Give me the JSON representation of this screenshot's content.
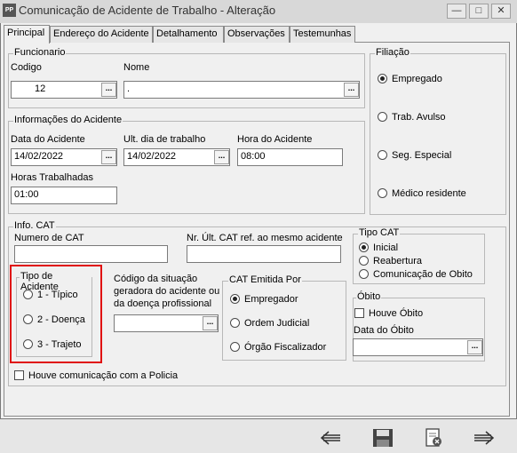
{
  "window": {
    "icon_text": "PP",
    "title": "Comunicação de Acidente de Trabalho - Alteração"
  },
  "tabs": [
    "Principal",
    "Endereço do Acidente",
    "Detalhamento",
    "Observações",
    "Testemunhas"
  ],
  "funcionario": {
    "group_label": "Funcionario",
    "codigo_label": "Codigo",
    "codigo_value": "12",
    "nome_label": "Nome",
    "nome_value": "."
  },
  "filiacao": {
    "group_label": "Filiação",
    "options": [
      "Empregado",
      "Trab. Avulso",
      "Seg. Especial",
      "Médico residente"
    ],
    "selected": "Empregado"
  },
  "acidente": {
    "group_label": "Informações do Acidente",
    "data_label": "Data do Acidente",
    "data_value": "14/02/2022",
    "ult_label": "Ult. dia de trabalho",
    "ult_value": "14/02/2022",
    "hora_label": "Hora do Acidente",
    "hora_value": "08:00",
    "horas_label": "Horas Trabalhadas",
    "horas_value": "01:00"
  },
  "cat": {
    "group_label": "Info. CAT",
    "numero_label": "Numero de CAT",
    "numero_value": "",
    "nr_ult_label": "Nr. Últ. CAT ref. ao mesmo acidente",
    "nr_ult_value": "",
    "tipo_cat_label": "Tipo CAT",
    "tipo_cat_options": [
      "Inicial",
      "Reabertura",
      "Comunicação de Obito"
    ],
    "tipo_cat_selected": "Inicial",
    "tipo_acidente_label": "Tipo de Acidente",
    "tipo_acidente_options": [
      "1 - Típico",
      "2 - Doença",
      "3 - Trajeto"
    ],
    "codigo_sit_label_1": "Código da situação",
    "codigo_sit_label_2": "geradora do acidente ou",
    "codigo_sit_label_3": "da doença profissional",
    "codigo_sit_value": "",
    "emitida_label": "CAT Emitida Por",
    "emitida_options": [
      "Empregador",
      "Ordem Judicial",
      "Órgão Fiscalizador"
    ],
    "emitida_selected": "Empregador",
    "obito_label": "Óbito",
    "houve_obito_label": "Houve Óbito",
    "data_obito_label": "Data do Óbito",
    "data_obito_value": "",
    "policia_label": "Houve comunicação com a Policia"
  },
  "colors": {
    "highlight_border": "#e01010"
  }
}
